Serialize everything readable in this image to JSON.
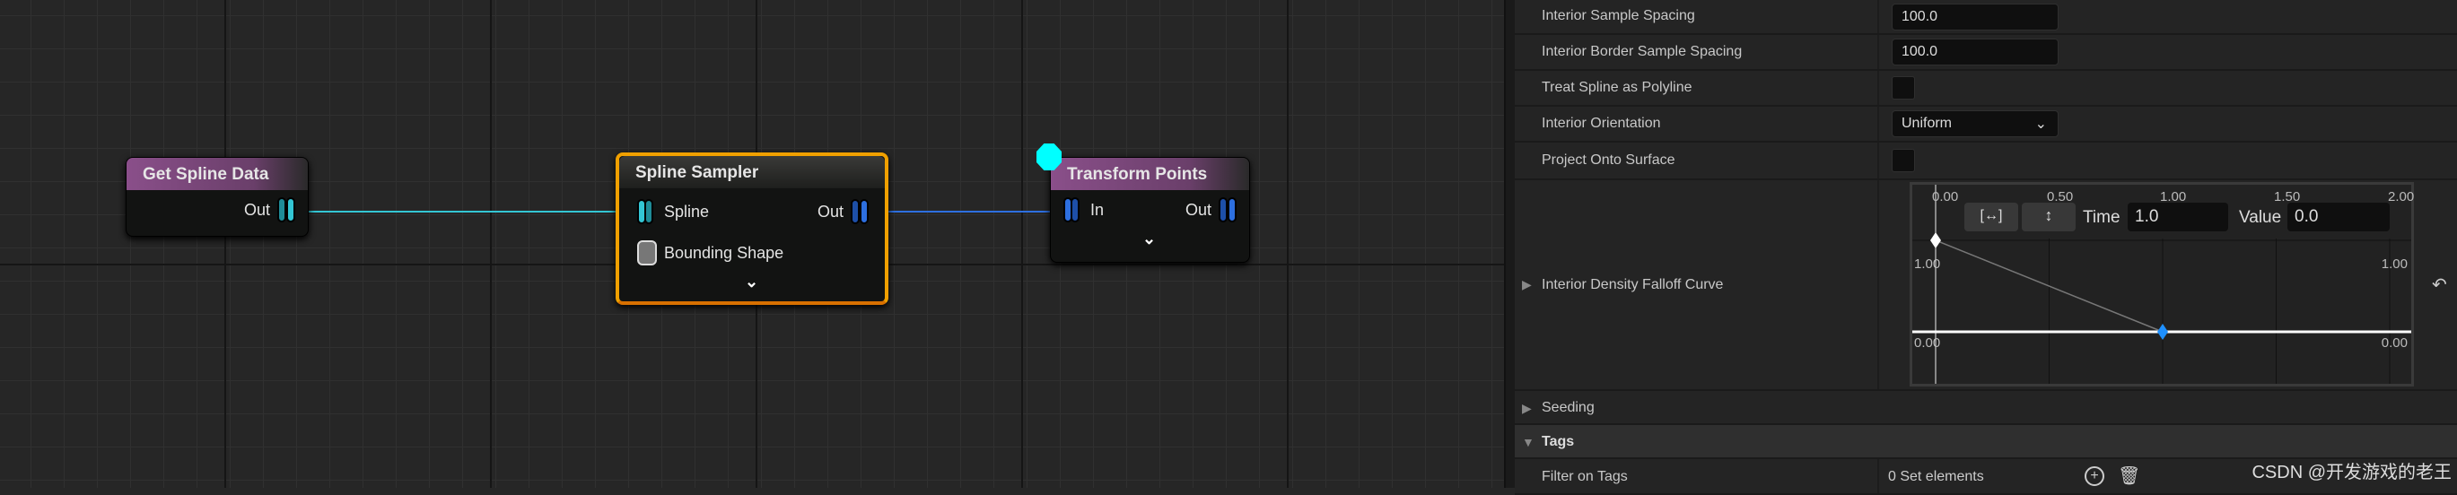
{
  "graph": {
    "nodes": [
      {
        "title": "Get Spline Data",
        "pins_out": [
          "Out"
        ],
        "pins_in": []
      },
      {
        "title": "Spline Sampler",
        "pins_in": [
          "Spline",
          "Bounding Shape"
        ],
        "pins_out": [
          "Out"
        ]
      },
      {
        "title": "Transform Points",
        "pins_in": [
          "In"
        ],
        "pins_out": [
          "Out"
        ]
      }
    ],
    "colors": {
      "spline_pin": "#33c6d4",
      "point_pin": "#2d6fe0",
      "selection": "#f0a000",
      "header": "#8a4f8a",
      "marker": "#00ffff"
    }
  },
  "details": {
    "rows": [
      {
        "label": "Interior Sample Spacing",
        "value": "100.0"
      },
      {
        "label": "Interior Border Sample Spacing",
        "value": "100.0"
      },
      {
        "label": "Treat Spline as Polyline",
        "checked": false
      },
      {
        "label": "Interior Orientation",
        "value": "Uniform"
      },
      {
        "label": "Project Onto Surface",
        "checked": false
      },
      {
        "label": "Interior Density Falloff Curve"
      }
    ],
    "curve": {
      "x_ticks": [
        "0.00",
        "0.50",
        "1.00",
        "1.50",
        "2.00"
      ],
      "y_labels": {
        "top_left": "1.00",
        "top_right": "1.00",
        "bottom_left": "0.00",
        "bottom_right": "0.00"
      },
      "time_label": "Time",
      "time_value": "1.0",
      "value_label": "Value",
      "value_value": "0.0",
      "keys": [
        {
          "time": 0,
          "value": 1
        },
        {
          "time": 1,
          "value": 0
        }
      ]
    },
    "seeding": "Seeding",
    "tags": "Tags",
    "filter_on_tags": {
      "label": "Filter on Tags",
      "value": "0 Set elements"
    }
  },
  "watermark": "CSDN @开发游戏的老王"
}
